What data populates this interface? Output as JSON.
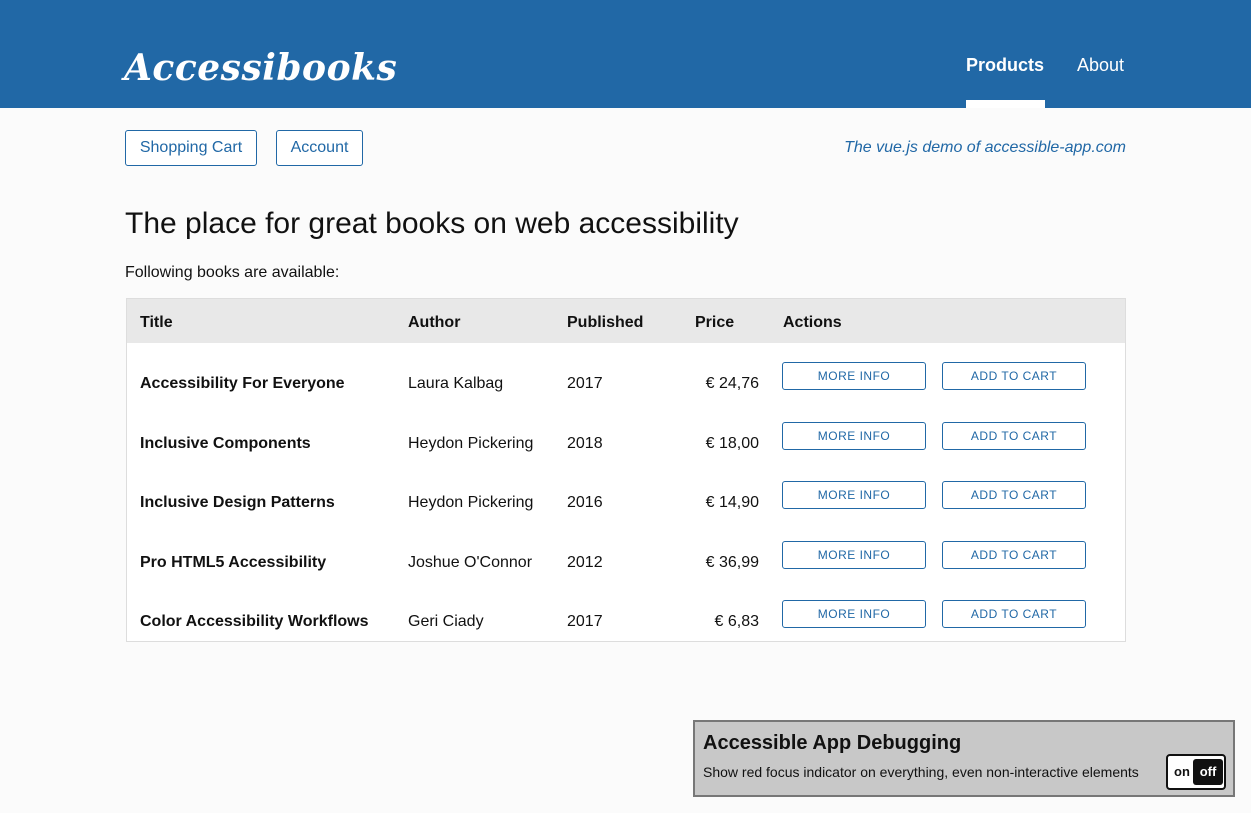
{
  "header": {
    "logo": "Accessibooks",
    "nav": [
      {
        "label": "Products",
        "active": true
      },
      {
        "label": "About",
        "active": false
      }
    ],
    "brand_color": "#2168a6"
  },
  "subnav": {
    "cart_label": "Shopping Cart",
    "account_label": "Account",
    "tagline": "The vue.js demo of accessible-app.com"
  },
  "main": {
    "title": "The place for great books on web accessibility",
    "intro": "Following books are available:",
    "table": {
      "columns": [
        "Title",
        "Author",
        "Published",
        "Price",
        "Actions"
      ],
      "rows": [
        {
          "title": "Accessibility For Everyone",
          "author": "Laura Kalbag",
          "published": "2017",
          "price": "€ 24,76"
        },
        {
          "title": "Inclusive Components",
          "author": "Heydon Pickering",
          "published": "2018",
          "price": "€ 18,00"
        },
        {
          "title": "Inclusive Design Patterns",
          "author": "Heydon Pickering",
          "published": "2016",
          "price": "€ 14,90"
        },
        {
          "title": "Pro HTML5 Accessibility",
          "author": "Joshue O'Connor",
          "published": "2012",
          "price": "€ 36,99"
        },
        {
          "title": "Color Accessibility Workflows",
          "author": "Geri Ciady",
          "published": "2017",
          "price": "€ 6,83"
        }
      ],
      "more_info_label": "MORE INFO",
      "add_to_cart_label": "ADD TO CART"
    }
  },
  "debug": {
    "title": "Accessible App Debugging",
    "description": "Show red focus indicator on everything, even non-interactive elements",
    "toggle_on": "on",
    "toggle_off": "off",
    "state": "off"
  }
}
